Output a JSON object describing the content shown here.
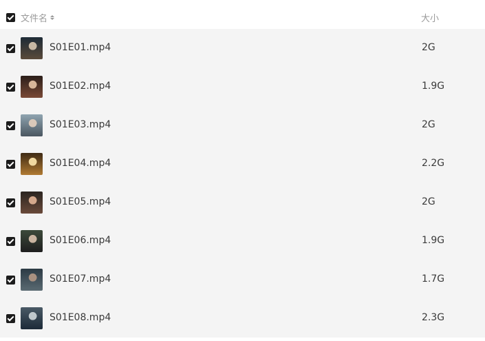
{
  "header": {
    "name_label": "文件名",
    "size_label": "大小"
  },
  "files": [
    {
      "name": "S01E01.mp4",
      "size": "2G",
      "thumb": [
        "#1d2a36",
        "#5b4a3a",
        "#c8b8a4"
      ]
    },
    {
      "name": "S01E02.mp4",
      "size": "1.9G",
      "thumb": [
        "#2b1e1a",
        "#7a4a36",
        "#d7b69a"
      ]
    },
    {
      "name": "S01E03.mp4",
      "size": "2G",
      "thumb": [
        "#8fa4b0",
        "#4a5660",
        "#d9c8b9"
      ]
    },
    {
      "name": "S01E04.mp4",
      "size": "2.2G",
      "thumb": [
        "#3e2a14",
        "#b07a32",
        "#f0d8a0"
      ]
    },
    {
      "name": "S01E05.mp4",
      "size": "2G",
      "thumb": [
        "#2a2420",
        "#6a4a3a",
        "#d4a88c"
      ]
    },
    {
      "name": "S01E06.mp4",
      "size": "1.9G",
      "thumb": [
        "#3c4a3a",
        "#1e1e1e",
        "#c9b4a0"
      ]
    },
    {
      "name": "S01E07.mp4",
      "size": "1.7G",
      "thumb": [
        "#2c3a44",
        "#5a6a72",
        "#a89080"
      ]
    },
    {
      "name": "S01E08.mp4",
      "size": "2.3G",
      "thumb": [
        "#4a5a66",
        "#1c2a38",
        "#c0c8cc"
      ]
    }
  ]
}
